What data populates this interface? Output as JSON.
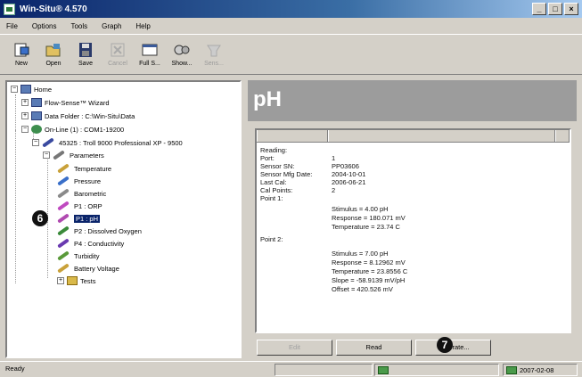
{
  "window": {
    "title": "Win-Situ® 4.570",
    "controls": [
      "_",
      "□",
      "×"
    ]
  },
  "menu": [
    "File",
    "Options",
    "Tools",
    "Graph",
    "Help"
  ],
  "toolbar": {
    "buttons": [
      {
        "label": "New",
        "icon": "new-icon",
        "enabled": true
      },
      {
        "label": "Open",
        "icon": "open-icon",
        "enabled": true
      },
      {
        "label": "Save",
        "icon": "save-icon",
        "enabled": true
      },
      {
        "label": "Cancel",
        "icon": "cancel-icon",
        "enabled": false
      },
      {
        "label": "Full S...",
        "icon": "full-screen-icon",
        "enabled": true
      },
      {
        "label": "Show...",
        "icon": "show-icon",
        "enabled": true
      },
      {
        "label": "Sens...",
        "icon": "sensor-icon",
        "enabled": false
      }
    ]
  },
  "tree": {
    "home": "Home",
    "flow_sense": "Flow-Sense™ Wizard",
    "data_folder": "Data Folder : C:\\Win-Situ\\Data",
    "online": "On-Line (1) : COM1-19200",
    "device": "45325 : Troll 9000 Professional XP - 9500",
    "parameters": "Parameters",
    "items": [
      {
        "label": "Temperature",
        "color": "#c9a13a"
      },
      {
        "label": "Pressure",
        "color": "#3a6fc9"
      },
      {
        "label": "Barometric",
        "color": "#8a8a8a"
      },
      {
        "label": "P1 : ORP",
        "color": "#c04ac0"
      },
      {
        "label": "P1 : pH",
        "color": "#b04ab0",
        "selected": true
      },
      {
        "label": "P2 : Dissolved Oxygen",
        "color": "#3a8a3a"
      },
      {
        "label": "P4 : Conductivity",
        "color": "#6a3ab0"
      },
      {
        "label": "Turbidity",
        "color": "#5a9a3a"
      },
      {
        "label": "Battery Voltage",
        "color": "#c9a13a"
      }
    ],
    "tests": "Tests"
  },
  "callouts": {
    "left": "6",
    "right": "7"
  },
  "panel": {
    "header": "pH",
    "report": {
      "reading_label": "Reading:",
      "rows": [
        {
          "label": "Port:",
          "value": "1"
        },
        {
          "label": "Sensor SN:",
          "value": "PP03606"
        },
        {
          "label": "Sensor Mfg Date:",
          "value": "2004-10-01"
        },
        {
          "label": "Last Cal:",
          "value": "2006-06-21"
        },
        {
          "label": "Cal Points:",
          "value": "2"
        }
      ],
      "point1": {
        "label": "Point 1:",
        "lines": [
          "Stimulus = 4.00 pH",
          "Response = 180.071 mV",
          "Temperature = 23.74 C"
        ]
      },
      "point2": {
        "label": "Point 2:",
        "lines": [
          "Stimulus = 7.00 pH",
          "Response = 8.12962 mV",
          "Temperature = 23.8556 C",
          "Slope = -58.9139 mV/pH",
          "Offset = 420.526 mV"
        ]
      }
    },
    "buttons": [
      {
        "label": "Edit",
        "enabled": false
      },
      {
        "label": "Read",
        "enabled": true
      },
      {
        "label": "Calibrate...",
        "enabled": true
      }
    ]
  },
  "status": {
    "text": "Ready",
    "date": "2007-02-08"
  }
}
